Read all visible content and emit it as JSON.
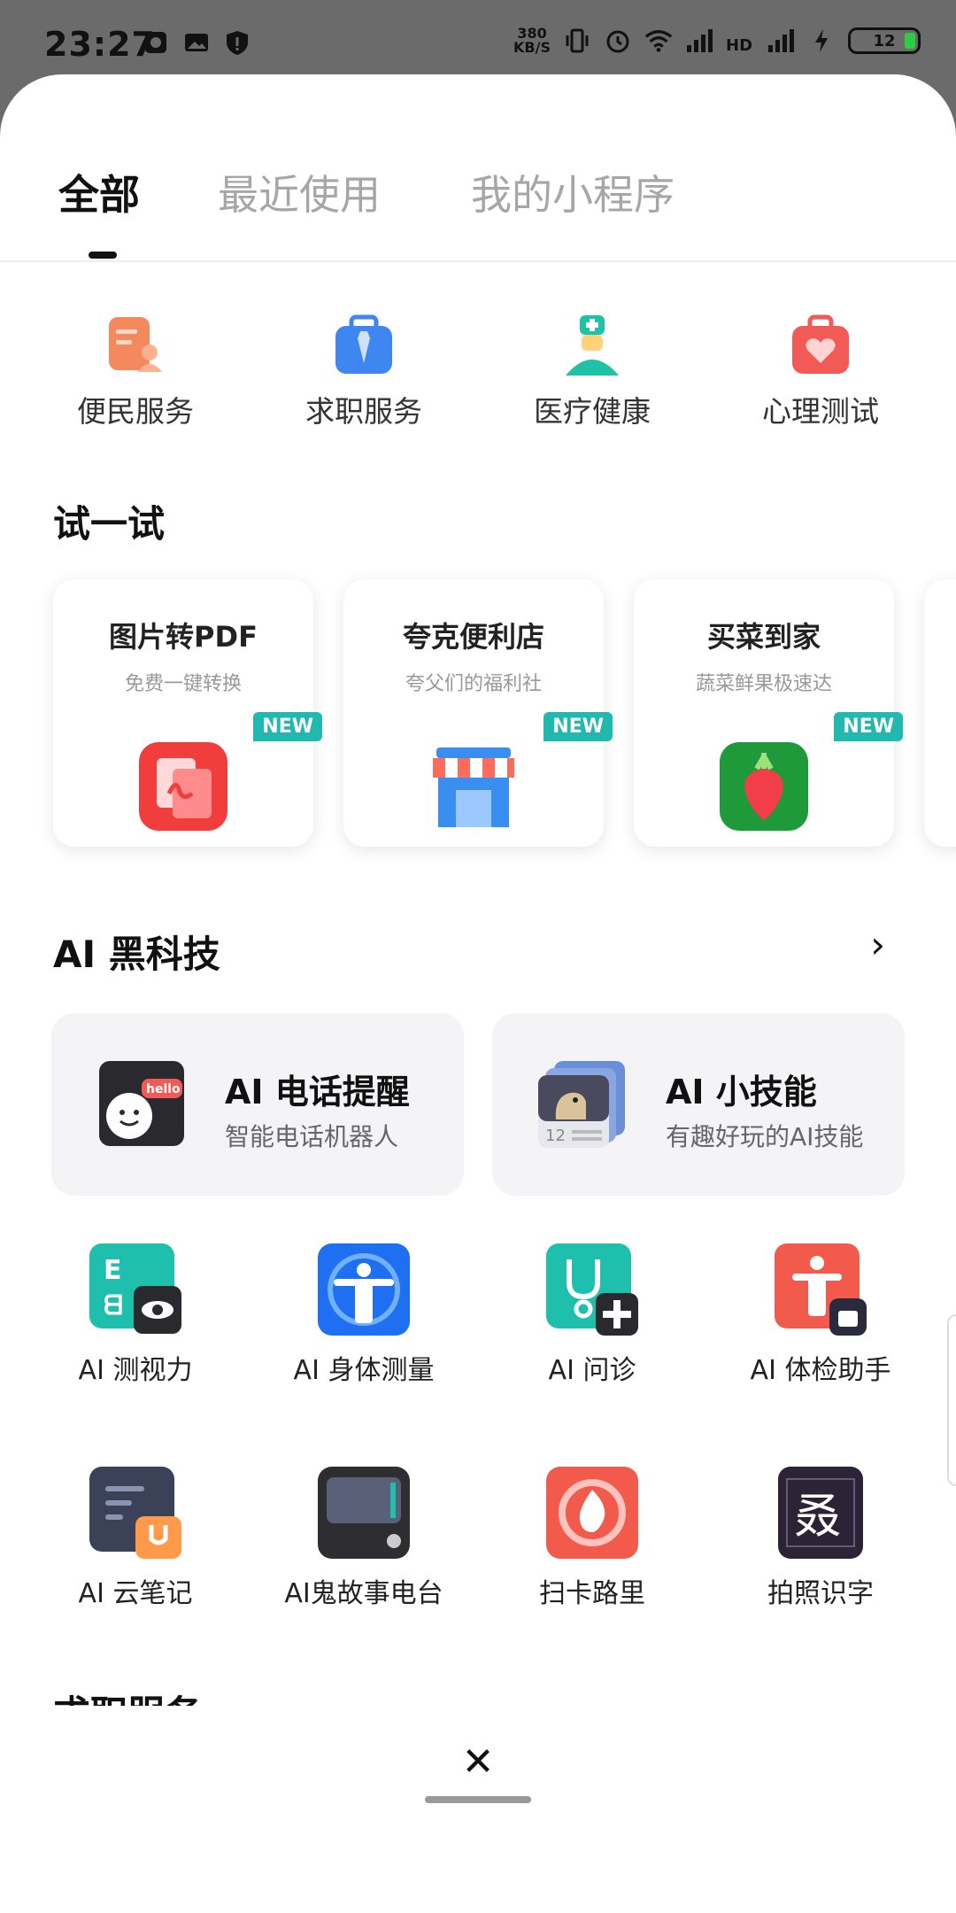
{
  "status_bar": {
    "time": "23:27",
    "speed_value": "380",
    "speed_unit": "KB/S",
    "battery": "12"
  },
  "tabs": [
    {
      "label": "全部",
      "active": true
    },
    {
      "label": "最近使用",
      "active": false
    },
    {
      "label": "我的小程序",
      "active": false
    }
  ],
  "quick_services": [
    {
      "label": "便民服务",
      "icon": "id-card-icon",
      "color": "#f4895e"
    },
    {
      "label": "求职服务",
      "icon": "briefcase-tie-icon",
      "color": "#3e86f0"
    },
    {
      "label": "医疗健康",
      "icon": "nurse-icon",
      "color": "#20c2a5"
    },
    {
      "label": "心理测试",
      "icon": "heart-bag-icon",
      "color": "#f25a55"
    }
  ],
  "try_section": {
    "title": "试一试",
    "badge": "NEW",
    "cards": [
      {
        "title": "图片转PDF",
        "subtitle": "免费一键转换",
        "icon": "pdf-icon",
        "color": "#f23d3d"
      },
      {
        "title": "夸克便利店",
        "subtitle": "夸父们的福利社",
        "icon": "store-icon",
        "color": "#3a8ef0"
      },
      {
        "title": "买菜到家",
        "subtitle": "蔬菜鲜果极速达",
        "icon": "radish-icon",
        "color": "#1f9a3a"
      }
    ]
  },
  "ai_section": {
    "title": "AI 黑科技",
    "more": "›",
    "feature_cards": [
      {
        "title": "AI 电话提醒",
        "subtitle": "智能电话机器人",
        "icon": "phone-robot-icon",
        "badge": "hello"
      },
      {
        "title": "AI 小技能",
        "subtitle": "有趣好玩的AI技能",
        "icon": "skills-stack-icon",
        "badge": "12"
      }
    ],
    "grid": [
      {
        "label": "AI 测视力",
        "icon": "eye-chart-icon",
        "color": "#1fbfae"
      },
      {
        "label": "AI 身体测量",
        "icon": "body-measure-icon",
        "color": "#1e6ff2"
      },
      {
        "label": "AI 问诊",
        "icon": "stethoscope-icon",
        "color": "#1fbfae"
      },
      {
        "label": "AI 体检助手",
        "icon": "body-check-icon",
        "color": "#f25a4c"
      },
      {
        "label": "AI 云笔记",
        "icon": "cloud-note-icon",
        "color": "#3b4257"
      },
      {
        "label": "AI鬼故事电台",
        "icon": "radio-icon",
        "color": "#3a3a3a"
      },
      {
        "label": "扫卡路里",
        "icon": "calorie-flame-icon",
        "color": "#f25a4c"
      },
      {
        "label": "拍照识字",
        "icon": "character-ocr-icon",
        "color": "#2a2a3a"
      }
    ]
  },
  "next_section_title": "求职服务",
  "close_label": "✕"
}
